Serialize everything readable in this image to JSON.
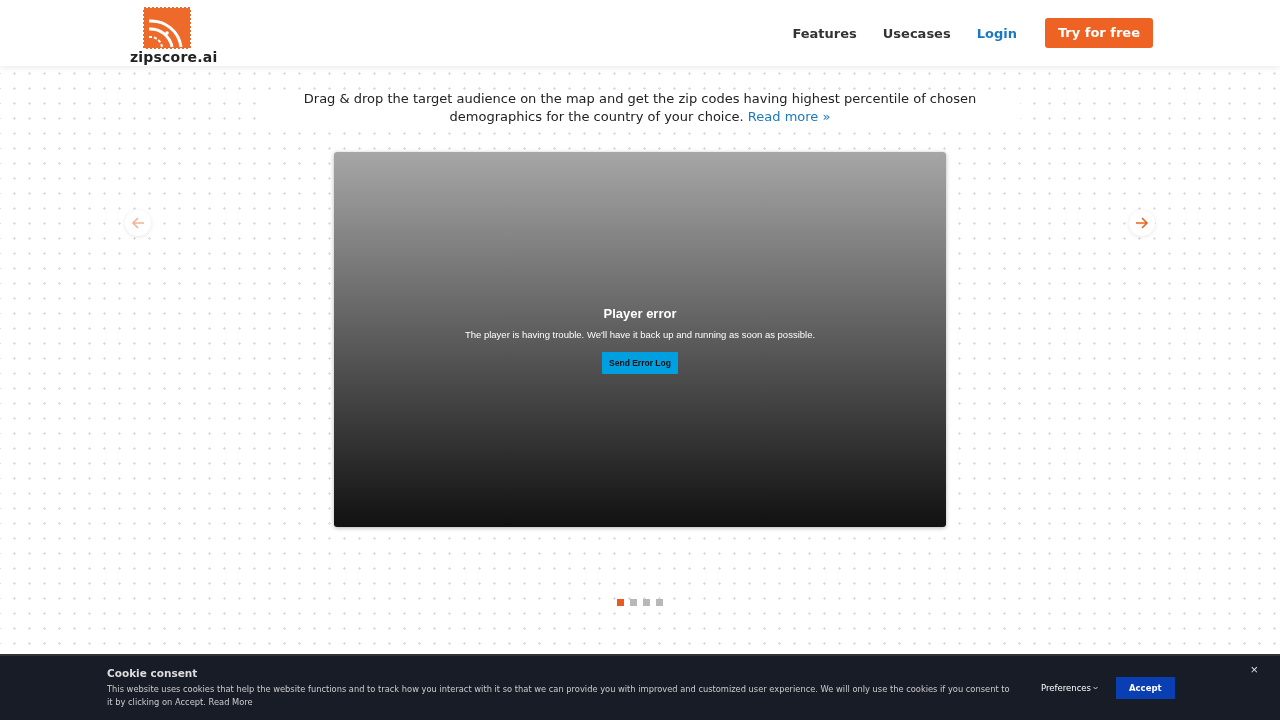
{
  "header": {
    "logo_text": "zipscore.ai",
    "nav": [
      {
        "label": "Features",
        "kind": "plain"
      },
      {
        "label": "Usecases",
        "kind": "plain"
      },
      {
        "label": "Login",
        "kind": "link"
      }
    ],
    "cta": "Try for free"
  },
  "intro": {
    "text": "Drag & drop the target audience on the map and get the zip codes having highest percentile of chosen demographics for the country of your choice.",
    "link": "Read more »"
  },
  "carousel": {
    "prev": {
      "disabled": true
    },
    "next": {
      "disabled": false
    },
    "player": {
      "title": "Player error",
      "message": "The player is having trouble. We'll have it back up and running as soon as possible.",
      "button": "Send Error Log"
    },
    "dots": [
      {
        "selected": true
      },
      {
        "selected": false
      },
      {
        "selected": false
      },
      {
        "selected": false
      }
    ]
  },
  "cookie": {
    "title": "Cookie consent",
    "text": "This website uses cookies that help the website functions and to track how you interact with it so that we can provide you with improved and customized user experience. We will only use the cookies if you consent to it by clicking on Accept.",
    "link": "Read More",
    "preferences": "Preferences",
    "accept": "Accept",
    "close": "×"
  }
}
